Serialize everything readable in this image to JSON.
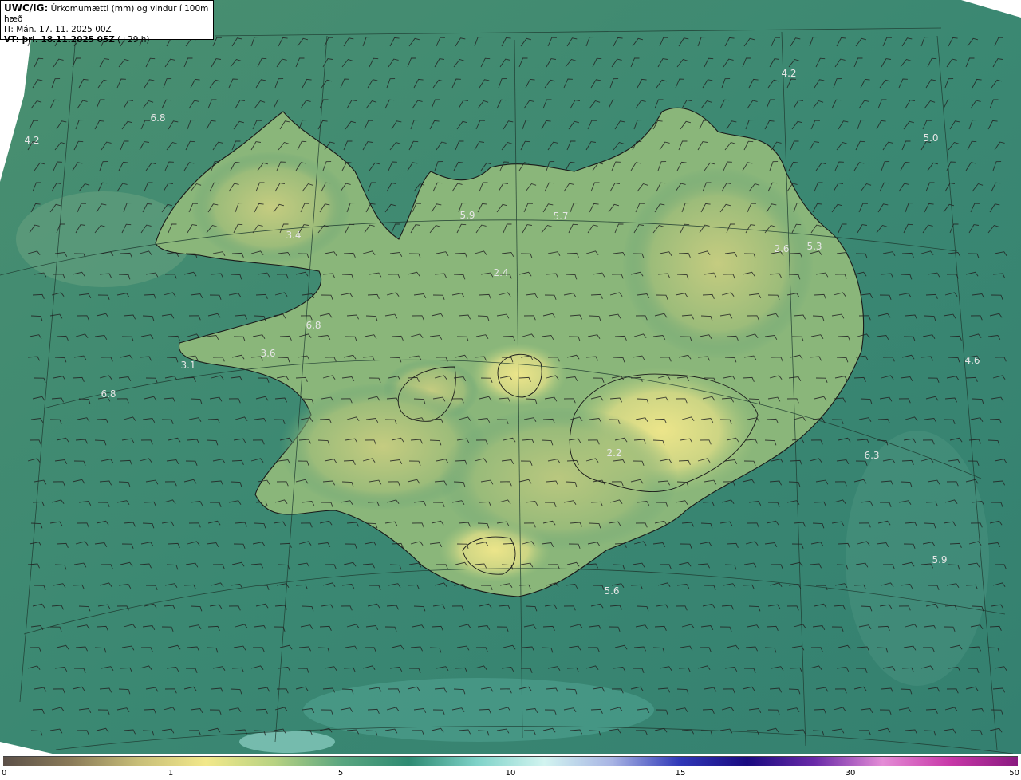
{
  "header": {
    "model_label": "UWC/IG:",
    "description": "Úrkomumætti (mm) og vindur í 100m hæð",
    "init_time": "IT: Mán. 17. 11. 2025 00Z",
    "valid_prefix": "VT: þri. 18.11.2025 05Z",
    "valid_offset": "(+29 h)"
  },
  "map_labels": [
    "4.2",
    "6.8",
    "4.2",
    "5.0",
    "3.4",
    "5.9",
    "5.7",
    "2.4",
    "2.6",
    "5.3",
    "6.8",
    "3.6",
    "3.1",
    "6.8",
    "4.6",
    "6.3",
    "2.2",
    "5.9",
    "5.6"
  ],
  "colorbar": {
    "ticks": [
      "0",
      "1",
      "5",
      "10",
      "15",
      "30",
      "50"
    ],
    "colors": [
      "#5c5048",
      "#8a7a58",
      "#c8be78",
      "#f2e88a",
      "#b8d282",
      "#5aa680",
      "#2e8a72",
      "#7ed2c8",
      "#d2f4f0",
      "#a8b4e4",
      "#3038b8",
      "#1a0a80",
      "#6a2aa8",
      "#e48cd6",
      "#c838a8",
      "#8a1a80"
    ]
  },
  "colors": {
    "sea": "#3d8a72",
    "land_low": "#6aa878",
    "land_high": "#e6e08a",
    "frame": "#1a1a1a"
  }
}
